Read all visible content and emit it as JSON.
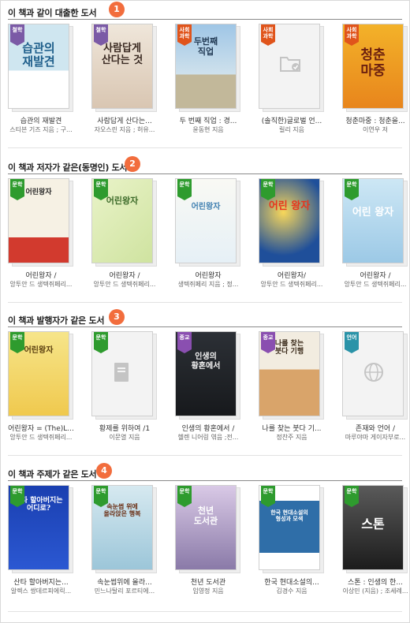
{
  "sections": [
    {
      "title": "이 책과 같이 대출한 도서",
      "number": "1",
      "books": [
        {
          "title": "습관의 재발견",
          "author": "스티븐 기즈 지음 ; 구...",
          "tag": "철학",
          "cover_text": "습관의\n재발견"
        },
        {
          "title": "사람답게 산다는...",
          "author": "자오스린 지음 ; 허유...",
          "tag": "철학",
          "cover_text": "사람답게\n산다는 것"
        },
        {
          "title": "두 번째 직업 : 경...",
          "author": "윤동현 지음",
          "tag": "사회\n과학",
          "cover_text": "두번째\n직업"
        },
        {
          "title": "(솔직한)글로벌 언...",
          "author": "릴리 지음",
          "tag": "사회\n과학",
          "cover_text": ""
        },
        {
          "title": "청춘마중 : 청춘을...",
          "author": "이연우 저",
          "tag": "사회\n과학",
          "cover_text": "청춘\n마중"
        }
      ]
    },
    {
      "title": "이 책과 저자가 같은(동명인) 도서",
      "number": "2",
      "books": [
        {
          "title": "어린왕자 /",
          "author": "앙투안 드 생텍쥐페리...",
          "tag": "문학",
          "cover_text": "어린왕자"
        },
        {
          "title": "어린왕자 /",
          "author": "앙투안 드 생텍쥐페리...",
          "tag": "문학",
          "cover_text": "어린왕자"
        },
        {
          "title": "어린왕자",
          "author": "생텍쥐페리 지음 ; 정...",
          "tag": "문학",
          "cover_text": "어린왕자"
        },
        {
          "title": "어린왕자/",
          "author": "앙투안 드 생텍쥐페리...",
          "tag": "문학",
          "cover_text": "어린 왕자"
        },
        {
          "title": "어린왕자 /",
          "author": "앙투안 드 생텍쥐페리...",
          "tag": "문학",
          "cover_text": "어린 왕자"
        }
      ]
    },
    {
      "title": "이 책과 발행자가 같은 도서",
      "number": "3",
      "books": [
        {
          "title": "어린왕자 = (The)L...",
          "author": "앙투안 드 생텍쥐페리...",
          "tag": "문학",
          "cover_text": "어린왕자"
        },
        {
          "title": "황제를 위하여 /1",
          "author": "이문열 지음",
          "tag": "문학",
          "cover_text": ""
        },
        {
          "title": "인생의 황혼에서 /",
          "author": "헬렌 니어링 엮음 ;전...",
          "tag": "종교",
          "cover_text": "인생의\n황혼에서"
        },
        {
          "title": "나를 찾는 붓다 기...",
          "author": "정찬주 지음",
          "tag": "종교",
          "cover_text": "나를 찾는\n붓다 기행"
        },
        {
          "title": "존재와 언어 /",
          "author": "마루야마 게이자부로...",
          "tag": "언어",
          "cover_text": ""
        }
      ]
    },
    {
      "title": "이 책과 주제가 같은 도서",
      "number": "4",
      "books": [
        {
          "title": "산타 할아버지는...",
          "author": "알렉스 쌍데르피에릭...",
          "tag": "문학",
          "cover_text": "산타 할아버지는\n어디로?"
        },
        {
          "title": "속눈썹위에 올라...",
          "author": "민느나탈리 포르티에...",
          "tag": "문학",
          "cover_text": "속눈썹 위에\n올라앉은 행복"
        },
        {
          "title": "천년 도서관",
          "author": "임영정 지음",
          "tag": "문학",
          "cover_text": "천년\n도서관"
        },
        {
          "title": "한국 현대소설의...",
          "author": "김경수 지음",
          "tag": "문학",
          "cover_text": "한국 현대소설의\n형성과 모색"
        },
        {
          "title": "스톤 : 인생의 한...",
          "author": "이상민 (지음) ; 조세례...",
          "tag": "문학",
          "cover_text": "스톤"
        }
      ]
    }
  ]
}
